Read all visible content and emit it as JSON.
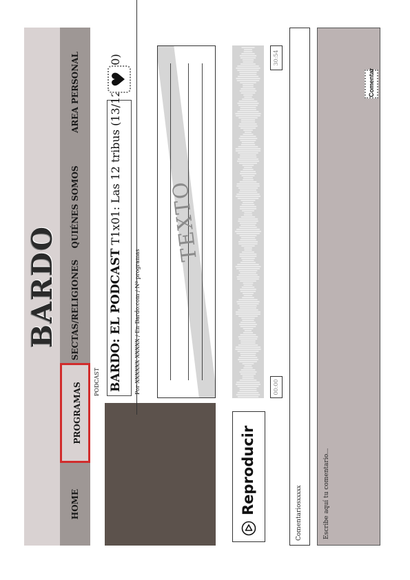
{
  "header": {
    "title": "BARDO"
  },
  "nav": {
    "items": [
      {
        "label": "HOME"
      },
      {
        "label": "PROGRAMAS"
      },
      {
        "label": "SECTAS/RELIGIONES"
      },
      {
        "label": "QUIÉNES SOMOS"
      },
      {
        "label": "AREA PERSONAL"
      }
    ],
    "active_index": 1,
    "active_border_color": "#d12c2c"
  },
  "episode": {
    "section_tag": "PODCAST",
    "title_bold": "BARDO: EL PODCAST",
    "title_rest": " T1x01: Las 12 tribus (13/12/2020)",
    "byline": "Por XXXXXX XXXXX / En Bardo.com / Nº programas",
    "favorite_icon": "heart-icon"
  },
  "content": {
    "text_placeholder": "TEXTO"
  },
  "player": {
    "play_label": "Reproducir",
    "play_icon": "play-icon",
    "time_start": "00:00",
    "time_end": "30:54"
  },
  "comments": {
    "label": "Comentarios",
    "count": "xxxxx",
    "input_placeholder": "Escribe aquí tu comentario...",
    "submit_label": "Comentar"
  },
  "colors": {
    "header_bg": "#d9d2d2",
    "nav_bg": "#9e9795",
    "image_placeholder": "#5c524c",
    "comment_area_bg": "#bcb3b3"
  }
}
